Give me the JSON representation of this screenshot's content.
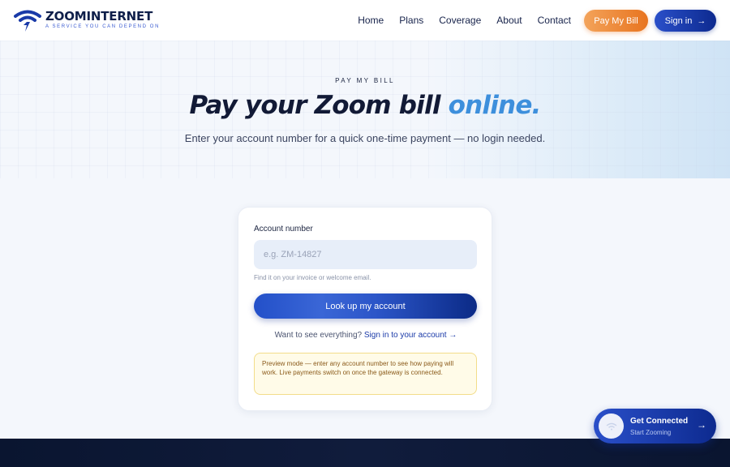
{
  "header": {
    "logo_name_part1": "ZOOM",
    "logo_name_part2": "INTERNET",
    "logo_tagline": "A SERVICE YOU CAN DEPEND ON",
    "nav": [
      "Home",
      "Plans",
      "Coverage",
      "About",
      "Contact"
    ],
    "pay_button": "Pay My Bill",
    "signin_button": "Sign in",
    "signin_arrow": "→"
  },
  "hero": {
    "eyebrow": "PAY MY BILL",
    "title_main": "Pay your Zoom bill ",
    "title_highlight": "online.",
    "subtitle": "Enter your account number for a quick one-time payment — no login needed."
  },
  "form": {
    "label": "Account number",
    "input_placeholder": "e.g. ZM-14827",
    "input_value": "",
    "help": "Find it on your invoice or welcome email.",
    "button": "Look up my account",
    "signin_prompt": "Want to see everything?",
    "signin_link": "Sign in to your account →",
    "notice": "Preview mode — enter any account number to see how paying will work. Live payments switch on once the gateway is connected."
  },
  "cta": {
    "title": "Get Connected",
    "subtitle": "Start Zooming",
    "arrow": "→",
    "icon": "wifi-icon"
  },
  "colors": {
    "brand_navy": "#0d2a8f",
    "accent_orange": "#e8741f",
    "highlight_blue": "#3d8fdc"
  }
}
